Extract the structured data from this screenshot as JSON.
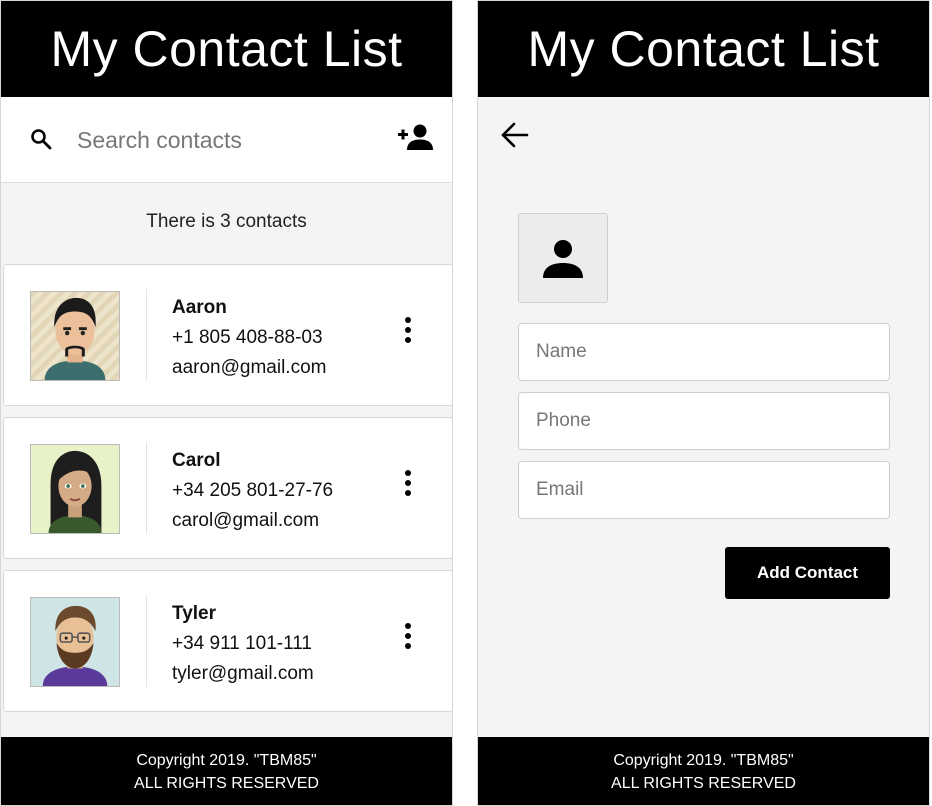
{
  "left_screen": {
    "header": {
      "title": "My Contact List"
    },
    "search": {
      "placeholder": "Search contacts",
      "value": "",
      "search_icon": "search-icon",
      "add_icon": "add-user-icon"
    },
    "count_text": "There is 3 contacts",
    "contacts": [
      {
        "name": "Aaron",
        "phone": "+1 805 408-88-03",
        "email": "aaron@gmail.com",
        "menu_icon": "kebab-menu-icon"
      },
      {
        "name": "Carol",
        "phone": "+34 205 801-27-76",
        "email": "carol@gmail.com",
        "menu_icon": "kebab-menu-icon"
      },
      {
        "name": "Tyler",
        "phone": "+34 911 101-111",
        "email": "tyler@gmail.com",
        "menu_icon": "kebab-menu-icon"
      }
    ],
    "footer": {
      "line1": "Copyright 2019. \"TBM85\"",
      "line2": "ALL RIGHTS RESERVED"
    }
  },
  "right_screen": {
    "header": {
      "title": "My Contact List"
    },
    "back_icon": "arrow-left-icon",
    "photo_icon": "person-icon",
    "form": {
      "name_placeholder": "Name",
      "phone_placeholder": "Phone",
      "email_placeholder": "Email",
      "submit_label": "Add Contact"
    },
    "footer": {
      "line1": "Copyright 2019. \"TBM85\"",
      "line2": "ALL RIGHTS RESERVED"
    }
  },
  "colors": {
    "header_bg": "#000000",
    "page_bg": "#f4f4f4",
    "card_bg": "#ffffff",
    "button_bg": "#000000"
  }
}
